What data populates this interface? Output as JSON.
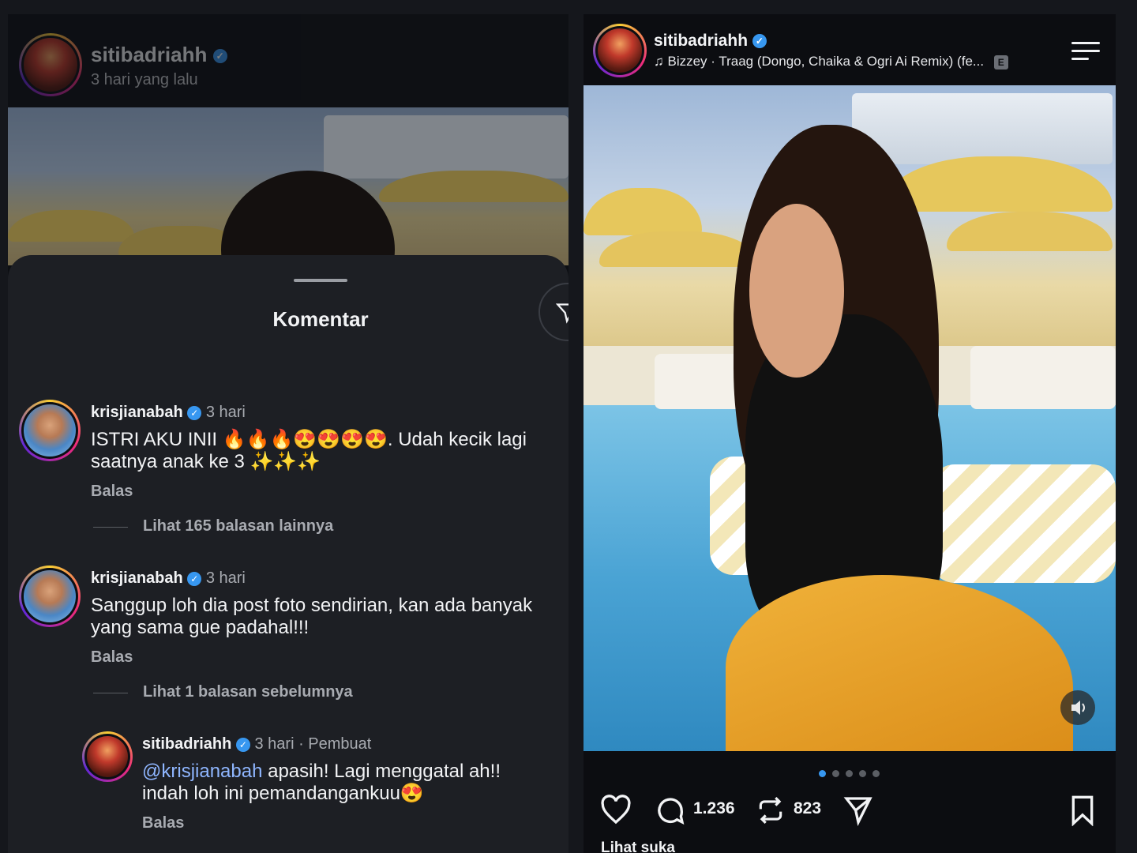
{
  "left": {
    "header": {
      "username": "sitibadriahh",
      "time": "3 hari yang lalu"
    },
    "sheet": {
      "title": "Komentar"
    },
    "comments": [
      {
        "username": "krisjianabah",
        "time": "3 hari",
        "text": "ISTRI AKU INII 🔥🔥🔥😍😍😍😍. Udah kecik lagi saatnya anak ke 3 ✨✨✨",
        "reply_label": "Balas",
        "more_label": "Lihat 165 balasan lainnya"
      },
      {
        "username": "krisjianabah",
        "time": "3 hari",
        "text": "Sanggup loh dia post foto sendirian, kan ada banyak yang sama gue padahal!!!",
        "reply_label": "Balas",
        "more_label": "Lihat 1 balasan sebelumnya"
      }
    ],
    "reply": {
      "username": "sitibadriahh",
      "time": "3 hari · Pembuat",
      "mention": "@krisjianabah",
      "text": " apasih! Lagi menggatal ah!! indah loh ini pemandangankuu😍",
      "reply_label": "Balas"
    }
  },
  "right": {
    "username": "sitibadriahh",
    "music": "Bizzey · Traag (Dongo, Chaika & Ogri Ai Remix) (fe...",
    "explicit_badge": "E",
    "comments_count": "1.236",
    "reposts_count": "823",
    "likes_label": "Lihat suka",
    "carousel": {
      "count": 5,
      "active_index": 0
    },
    "icons": [
      "music-icon",
      "menu-icon",
      "sound-icon",
      "heart-icon",
      "comment-icon",
      "repost-icon",
      "share-icon",
      "bookmark-icon"
    ]
  },
  "colors": {
    "verified": "#3797f0",
    "sheet_bg": "#1d1f24",
    "muted_text": "#a8abb1",
    "mention": "#8fb6ff"
  }
}
